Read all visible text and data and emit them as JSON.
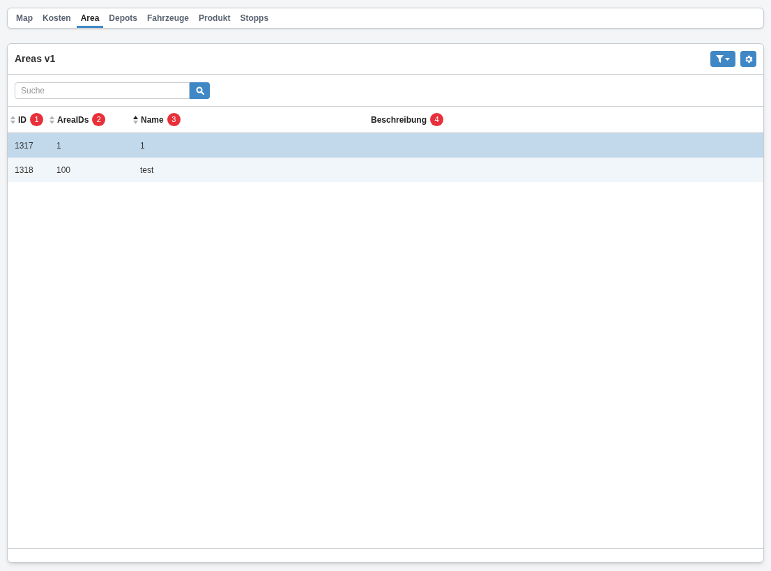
{
  "tabs": [
    {
      "label": "Map",
      "selected": false
    },
    {
      "label": "Kosten",
      "selected": false
    },
    {
      "label": "Area",
      "selected": true
    },
    {
      "label": "Depots",
      "selected": false
    },
    {
      "label": "Fahrzeuge",
      "selected": false
    },
    {
      "label": "Produkt",
      "selected": false
    },
    {
      "label": "Stopps",
      "selected": false
    }
  ],
  "panel": {
    "title": "Areas v1"
  },
  "search": {
    "placeholder": "Suche"
  },
  "table": {
    "columns": [
      {
        "label": "ID",
        "badge": "1",
        "sortable": true,
        "sorted": false
      },
      {
        "label": "AreaIDs",
        "badge": "2",
        "sortable": true,
        "sorted": false
      },
      {
        "label": "Name",
        "badge": "3",
        "sortable": true,
        "sorted": true
      },
      {
        "label": "Beschreibung",
        "badge": "4",
        "sortable": false
      }
    ],
    "rows": [
      {
        "cells": [
          "1317",
          "1",
          "1"
        ],
        "selected": true
      },
      {
        "cells": [
          "1318",
          "100",
          "test"
        ],
        "selected": false
      }
    ]
  }
}
